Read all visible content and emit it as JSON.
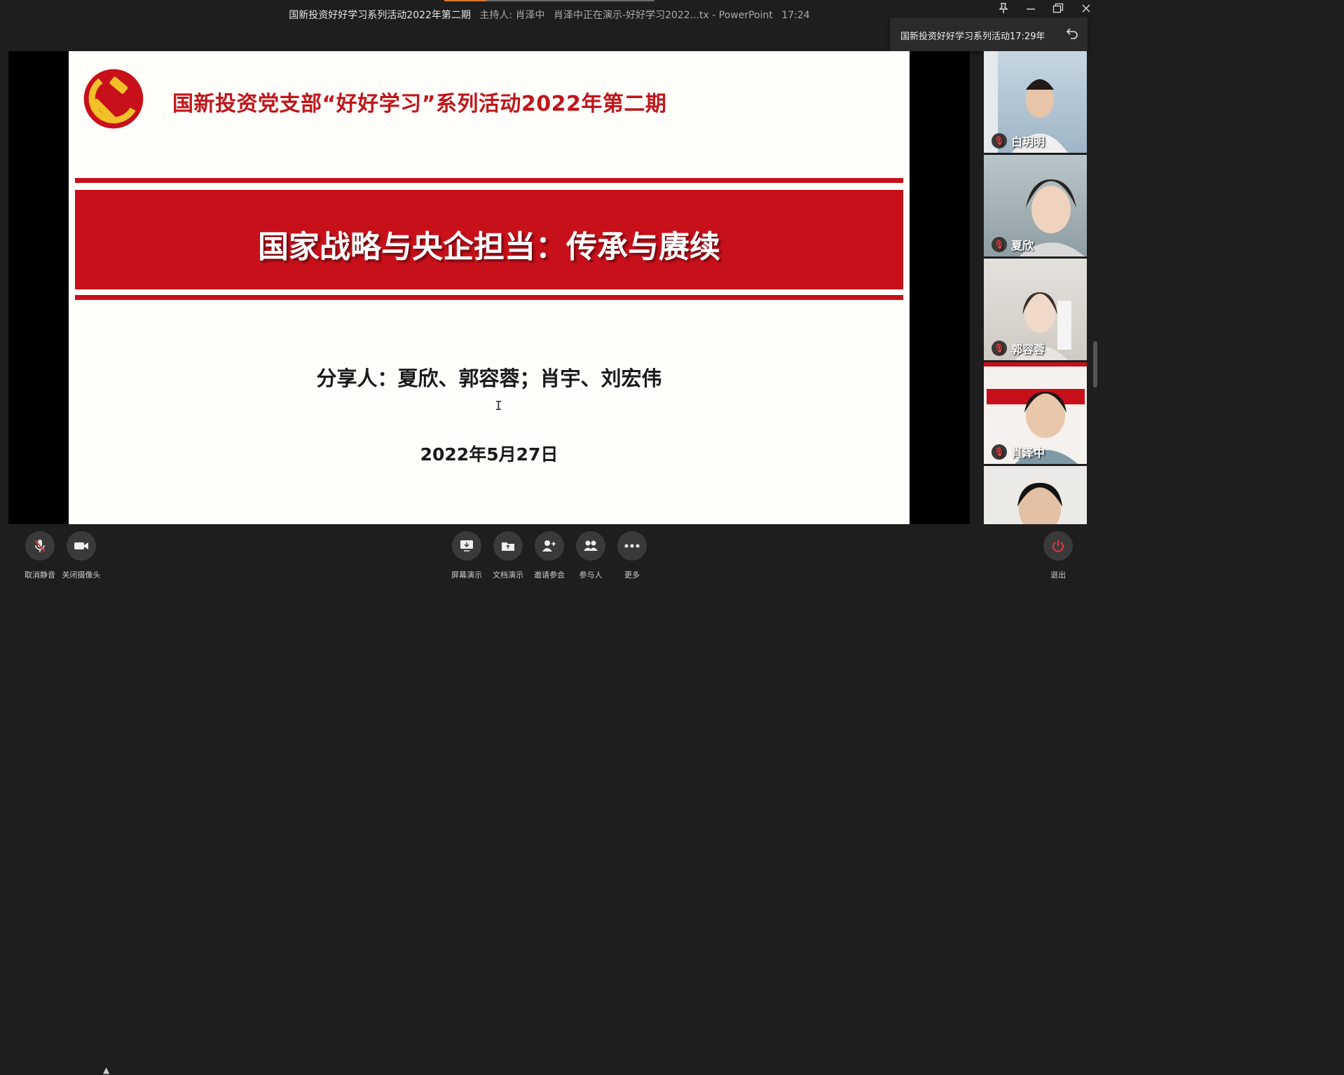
{
  "window": {
    "title": "国新投资好好学习系列活动2022年第二期",
    "host": "主持人: 肖泽中",
    "presenting": "肖泽中正在演示-好好学习2022...tx - PowerPoint",
    "time": "17:24",
    "controls": {
      "pin": "pin-icon",
      "minimize": "minimize-icon",
      "restore": "restore-icon",
      "close": "close-icon"
    }
  },
  "toast": {
    "text": "国新投资好好学习系列活动17:29年",
    "icon": "return-icon"
  },
  "slide": {
    "header": "国新投资党支部“好好学习”系列活动2022年第二期",
    "main_title": "国家战略与央企担当：传承与赓续",
    "sharer": "分享人：夏欣、郭容蓉；肖宇、刘宏伟",
    "date": "2022年5月27日",
    "colors": {
      "accent": "#c8101a",
      "background": "#fffefa"
    }
  },
  "participants": [
    {
      "name": "白玥明",
      "muted": true
    },
    {
      "name": "夏欣",
      "muted": true
    },
    {
      "name": "郭容蓉",
      "muted": true
    },
    {
      "name": "肖泽中",
      "muted": true
    },
    {
      "name": "",
      "muted": false
    }
  ],
  "toolbar": {
    "unmute": "取消静音",
    "camera_off": "关闭摄像头",
    "screen_share": "屏幕演示",
    "doc_share": "文档演示",
    "invite": "邀请参会",
    "participants": "参与人",
    "more": "更多",
    "exit": "退出"
  }
}
